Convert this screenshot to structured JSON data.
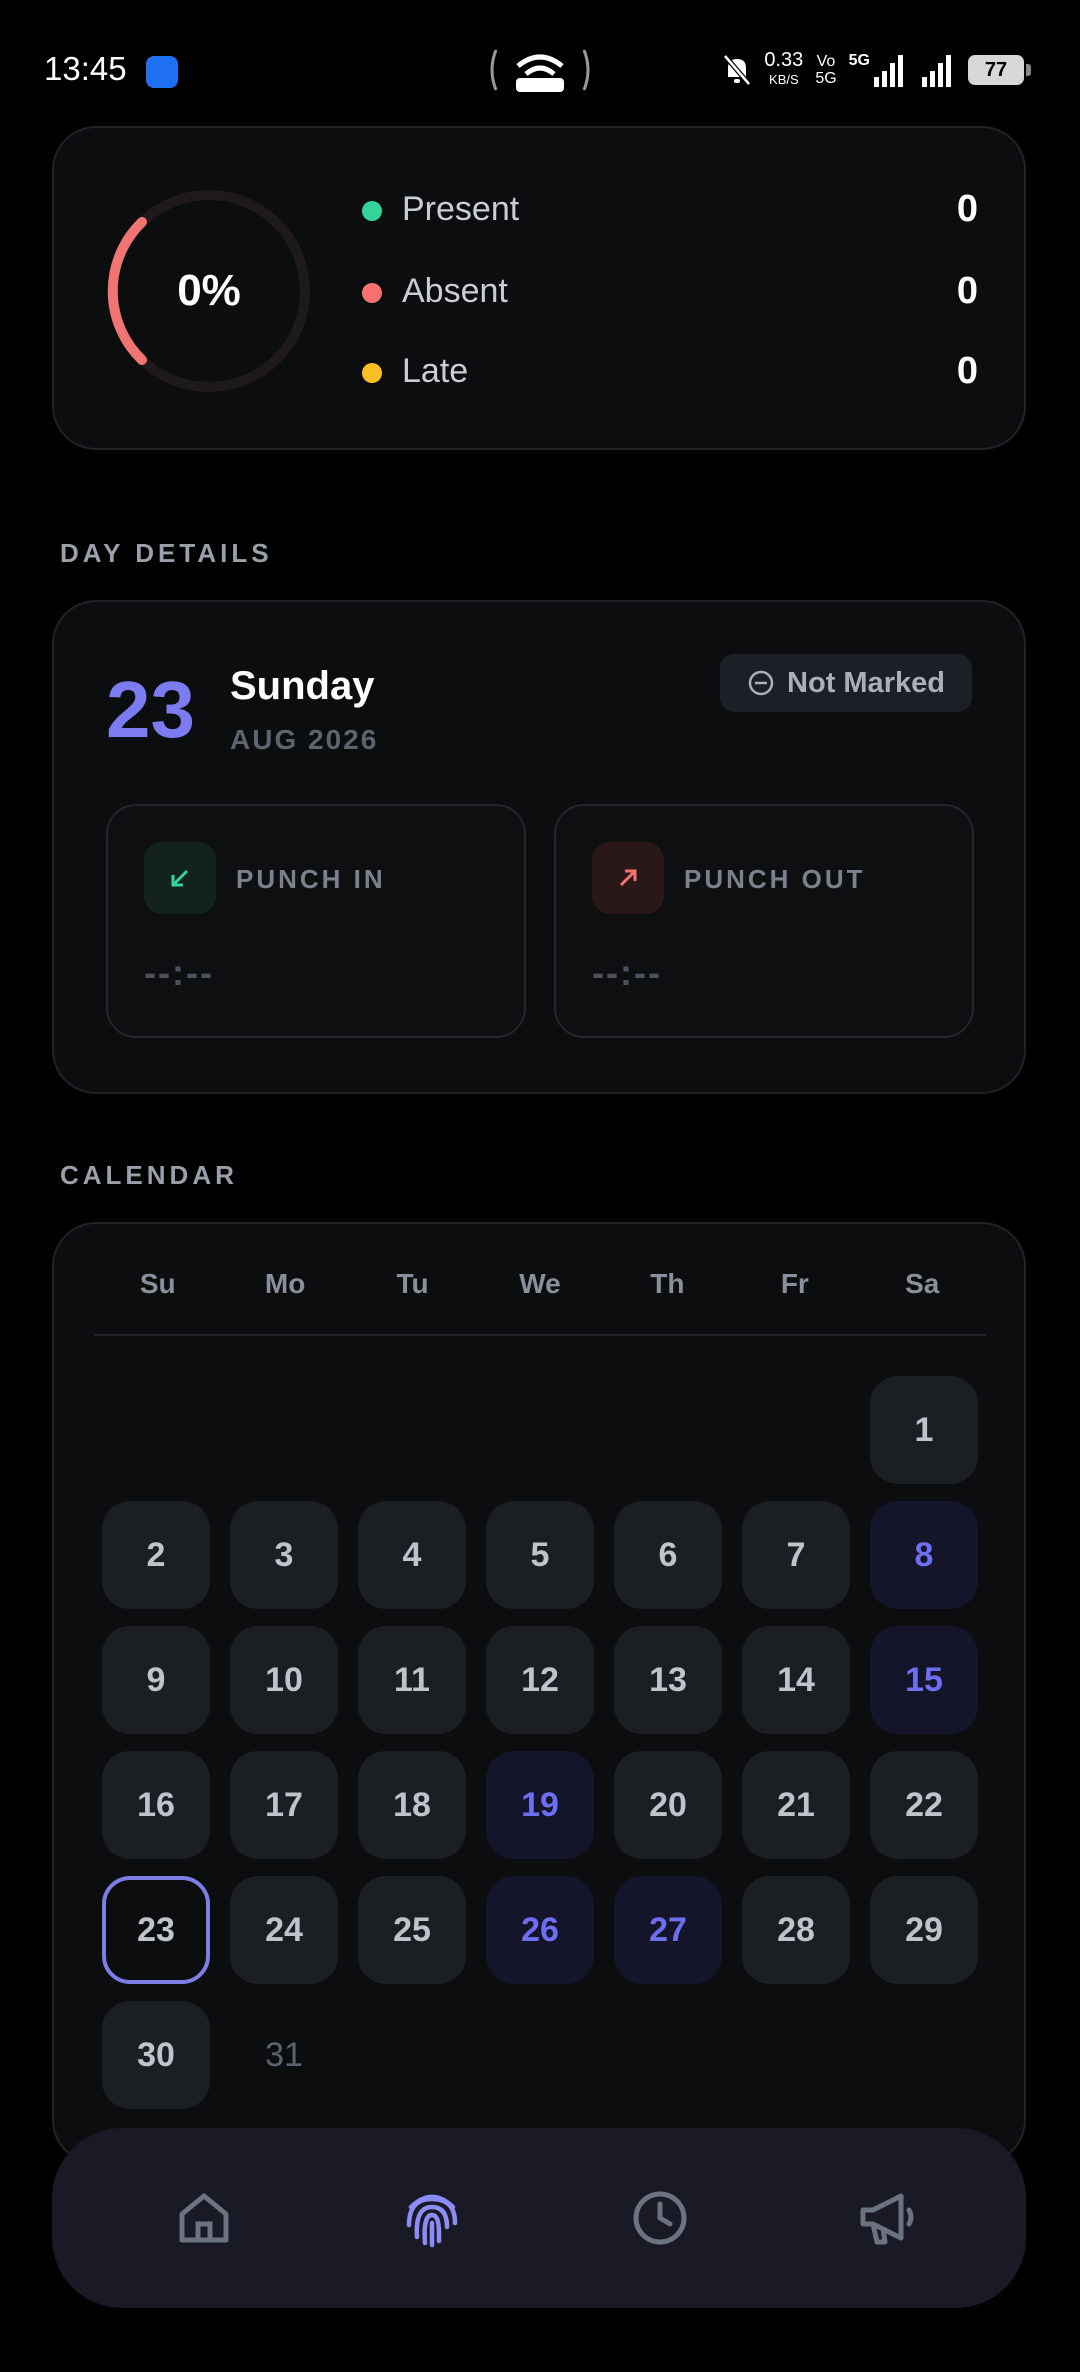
{
  "status_bar": {
    "time": "13:45",
    "speed": "0.33",
    "speed_unit": "KB/S",
    "volte": "Vo",
    "volte2": "5G",
    "network": "5G",
    "battery": "77"
  },
  "summary": {
    "percent": "0%",
    "progress": 0,
    "legend": [
      {
        "label": "Present",
        "value": "0",
        "color": "#34d399"
      },
      {
        "label": "Absent",
        "value": "0",
        "color": "#f87171"
      },
      {
        "label": "Late",
        "value": "0",
        "color": "#fbbf24"
      }
    ]
  },
  "day_details": {
    "section_title": "DAY DETAILS",
    "day_number": "23",
    "day_name": "Sunday",
    "month_year": "AUG 2026",
    "status_badge": "Not Marked",
    "punch_in": {
      "label": "PUNCH IN",
      "value": "--:--"
    },
    "punch_out": {
      "label": "PUNCH OUT",
      "value": "--:--"
    }
  },
  "calendar": {
    "section_title": "CALENDAR",
    "weekdays": [
      "Su",
      "Mo",
      "Tu",
      "We",
      "Th",
      "Fr",
      "Sa"
    ],
    "days": [
      {
        "day": "1",
        "style": "normal"
      },
      {
        "day": "2",
        "style": "normal"
      },
      {
        "day": "3",
        "style": "normal"
      },
      {
        "day": "4",
        "style": "normal"
      },
      {
        "day": "5",
        "style": "normal"
      },
      {
        "day": "6",
        "style": "normal"
      },
      {
        "day": "7",
        "style": "normal"
      },
      {
        "day": "8",
        "style": "blue"
      },
      {
        "day": "9",
        "style": "normal"
      },
      {
        "day": "10",
        "style": "normal"
      },
      {
        "day": "11",
        "style": "normal"
      },
      {
        "day": "12",
        "style": "normal"
      },
      {
        "day": "13",
        "style": "normal"
      },
      {
        "day": "14",
        "style": "normal"
      },
      {
        "day": "15",
        "style": "blue"
      },
      {
        "day": "16",
        "style": "normal"
      },
      {
        "day": "17",
        "style": "normal"
      },
      {
        "day": "18",
        "style": "normal"
      },
      {
        "day": "19",
        "style": "blue"
      },
      {
        "day": "20",
        "style": "normal"
      },
      {
        "day": "21",
        "style": "normal"
      },
      {
        "day": "22",
        "style": "normal"
      },
      {
        "day": "23",
        "style": "selected"
      },
      {
        "day": "24",
        "style": "normal"
      },
      {
        "day": "25",
        "style": "normal"
      },
      {
        "day": "26",
        "style": "blue"
      },
      {
        "day": "27",
        "style": "blue"
      },
      {
        "day": "28",
        "style": "normal"
      },
      {
        "day": "29",
        "style": "normal"
      },
      {
        "day": "30",
        "style": "normal"
      },
      {
        "day": "31",
        "style": "plain"
      }
    ]
  },
  "bottom_nav": {
    "items": [
      {
        "icon": "home-icon",
        "active": false
      },
      {
        "icon": "fingerprint-icon",
        "active": true
      },
      {
        "icon": "clock-icon",
        "active": false
      },
      {
        "icon": "megaphone-icon",
        "active": false
      }
    ],
    "active_color": "#8b8cf6",
    "inactive_color": "#6b7280"
  }
}
